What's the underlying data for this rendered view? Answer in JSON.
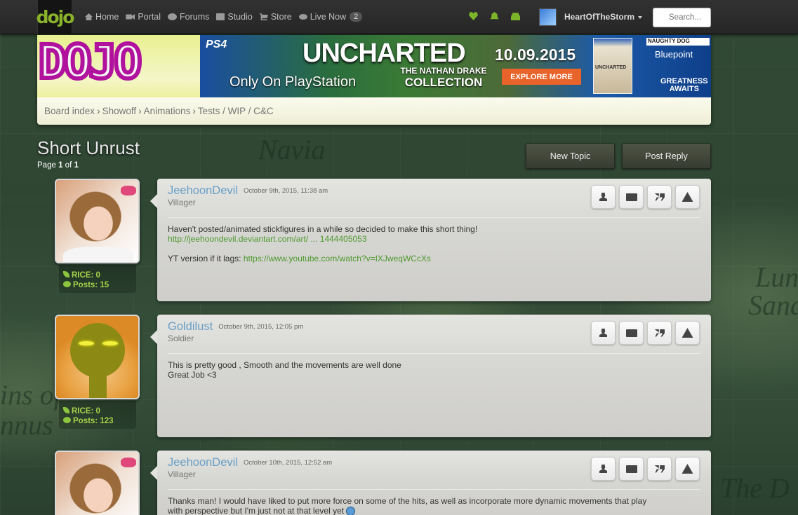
{
  "nav": {
    "logo": "dojo",
    "items": [
      {
        "label": "Home",
        "icon": "home-icon"
      },
      {
        "label": "Portal",
        "icon": "video-camera-icon"
      },
      {
        "label": "Forums",
        "icon": "chat-bubbles-icon"
      },
      {
        "label": "Studio",
        "icon": "film-icon"
      },
      {
        "label": "Store",
        "icon": "cart-icon"
      },
      {
        "label": "Live Now",
        "icon": "eye-icon",
        "badge": "2"
      }
    ],
    "right_icons": [
      "heart-icon",
      "bell-icon",
      "inbox-icon"
    ],
    "username": "HeartOfTheStorm",
    "search_placeholder": "Search..."
  },
  "banner": {
    "site_logo": "DOJO",
    "ad": {
      "platform": "PS4",
      "title": "UNCHARTED",
      "date": "10.09.2015",
      "subtitle_line1": "THE NATHAN DRAKE",
      "subtitle_line2": "COLLECTION",
      "only_on": "Only On PlayStation",
      "button": "EXPLORE MORE",
      "box_label": "UNCHARTED",
      "studio1": "NAUGHTY DOG",
      "studio2": "Bluepoint",
      "tagline1": "GREATNESS",
      "tagline2": "AWAITS"
    }
  },
  "breadcrumbs": [
    "Board index",
    "Showoff",
    "Animations",
    "Tests / WIP / C&C"
  ],
  "topic": {
    "title": "Short Unrust",
    "page_label": "Page",
    "page_current": "1",
    "page_of": "of",
    "page_total": "1"
  },
  "buttons": {
    "new_topic": "New Topic",
    "post_reply": "Post Reply"
  },
  "posts": [
    {
      "author": "JeehoonDevil",
      "date": "October 9th, 2015, 11:38 am",
      "rank": "Villager",
      "rice": "RICE: 0",
      "posts": "Posts: 15",
      "line1": "Haven't posted/animated stickfigures in a while so decided to make this short thing!",
      "link1": "http://jeehoondevil.deviantart.com/art/ ... 1444405053",
      "line2_prefix": "YT version if it lags: ",
      "link2": "https://www.youtube.com/watch?v=IXJweqWCcXs"
    },
    {
      "author": "Goldilust",
      "date": "October 9th, 2015, 12:05 pm",
      "rank": "Soldier",
      "rice": "RICE: 0",
      "posts": "Posts: 123",
      "line1": "This is pretty good , Smooth and the movements are well done",
      "line2": "Great Job <3"
    },
    {
      "author": "JeehoonDevil",
      "date": "October 10th, 2015, 12:52 am",
      "rank": "Villager",
      "line1": "Thanks man! I would have liked to put more force on some of the hits, as well as incorporate more dynamic movements that play",
      "line2": "with perspective but I'm just not at that level yet"
    }
  ],
  "background_text": [
    "Navia",
    "Lun",
    "Sand",
    "ins of",
    "nnus",
    "The D"
  ]
}
